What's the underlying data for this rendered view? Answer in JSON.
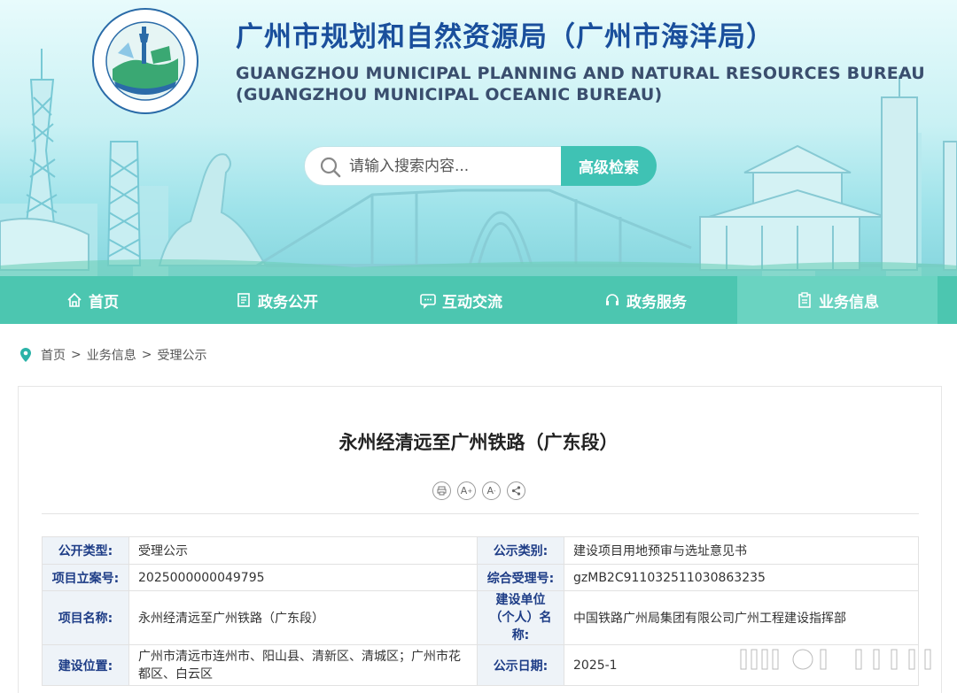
{
  "header": {
    "title": "广州市规划和自然资源局（广州市海洋局）",
    "subtitle_line1": "GUANGZHOU MUNICIPAL PLANNING AND NATURAL RESOURCES BUREAU",
    "subtitle_line2": "(GUANGZHOU MUNICIPAL OCEANIC BUREAU)",
    "logo_ring_text": "广州市规划和自然资源局 GUANGZHOU MUNICIPAL PLANNING AND NATURAL RESOURCES BUREAU"
  },
  "search": {
    "placeholder": "请输入搜索内容...",
    "advanced_label": "高级检索"
  },
  "nav": {
    "items": [
      {
        "label": "首页",
        "icon": "home-icon"
      },
      {
        "label": "政务公开",
        "icon": "document-icon"
      },
      {
        "label": "互动交流",
        "icon": "chat-icon"
      },
      {
        "label": "政务服务",
        "icon": "headset-icon"
      },
      {
        "label": "业务信息",
        "icon": "clipboard-icon"
      }
    ],
    "active_index": 4
  },
  "breadcrumb": {
    "home": "首页",
    "sep": ">",
    "level1": "业务信息",
    "level2": "受理公示"
  },
  "article": {
    "title": "永州经清远至广州铁路（广东段）"
  },
  "tools": [
    "print-icon",
    "font-larger-icon",
    "font-smaller-icon",
    "share-icon"
  ],
  "table": {
    "rows": [
      {
        "k1": "公开类型:",
        "v1": "受理公示",
        "k2": "公示类别:",
        "v2": "建设项目用地预审与选址意见书"
      },
      {
        "k1": "项目立案号:",
        "v1": "2025000000049795",
        "k2": "综合受理号:",
        "v2": "gzMB2C911032511030863235"
      },
      {
        "k1": "项目名称:",
        "v1": "永州经清远至广州铁路（广东段）",
        "k2": "建设单位（个人）名称:",
        "v2": "中国铁路广州局集团有限公司广州工程建设指挥部"
      },
      {
        "k1": "建设位置:",
        "v1": "广州市清远市连州市、阳山县、清新区、清城区；广州市花都区、白云区",
        "k2": "公示日期:",
        "v2": "2025-1"
      }
    ]
  },
  "colors": {
    "nav_bg": "#4cc6b0",
    "nav_active": "#6ad3c1",
    "title_blue": "#1a4f9c",
    "key_blue": "#1d3c86",
    "search_btn": "#3fc2b4"
  }
}
